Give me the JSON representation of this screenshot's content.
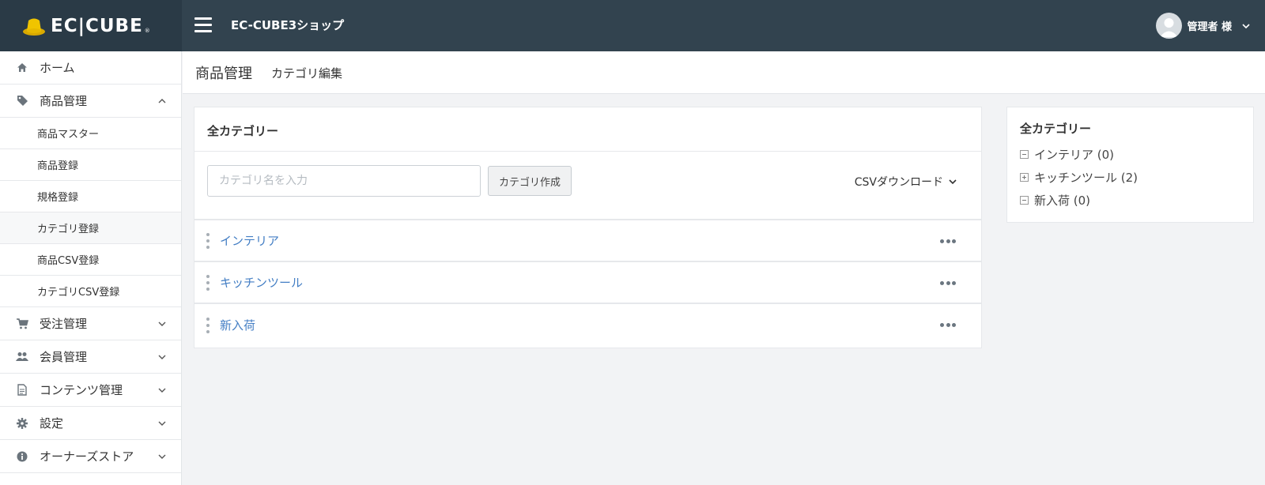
{
  "header": {
    "logo_text": "EC|CUBE",
    "logo_mark": "®",
    "shop_name": "EC-CUBE3ショップ",
    "user_name": "管理者 様",
    "colors": {
      "header_bg": "#32434f",
      "logo_bg": "#2a3a46",
      "hat": "#f0c400"
    }
  },
  "sidebar": {
    "items": [
      {
        "label": "ホーム",
        "icon": "home-icon"
      },
      {
        "label": "商品管理",
        "icon": "tag-icon",
        "expanded": true,
        "children": [
          "商品マスター",
          "商品登録",
          "規格登録",
          "カテゴリ登録",
          "商品CSV登録",
          "カテゴリCSV登録"
        ],
        "active_child": "カテゴリ登録"
      },
      {
        "label": "受注管理",
        "icon": "cart-icon"
      },
      {
        "label": "会員管理",
        "icon": "users-icon"
      },
      {
        "label": "コンテンツ管理",
        "icon": "file-icon"
      },
      {
        "label": "設定",
        "icon": "gear-icon"
      },
      {
        "label": "オーナーズストア",
        "icon": "info-icon"
      }
    ]
  },
  "page": {
    "title": "商品管理",
    "subtitle": "カテゴリ編集"
  },
  "category_card": {
    "heading": "全カテゴリー",
    "input_placeholder": "カテゴリ名を入力",
    "create_button": "カテゴリ作成",
    "csv_download": "CSVダウンロード",
    "rows": [
      "インテリア",
      "キッチンツール",
      "新入荷"
    ],
    "link_color": "#437ec4"
  },
  "tree": {
    "title": "全カテゴリー",
    "nodes": [
      {
        "label": "インテリア (0)",
        "toggle": "minus"
      },
      {
        "label": "キッチンツール (2)",
        "toggle": "plus"
      },
      {
        "label": "新入荷 (0)",
        "toggle": "minus"
      }
    ]
  }
}
